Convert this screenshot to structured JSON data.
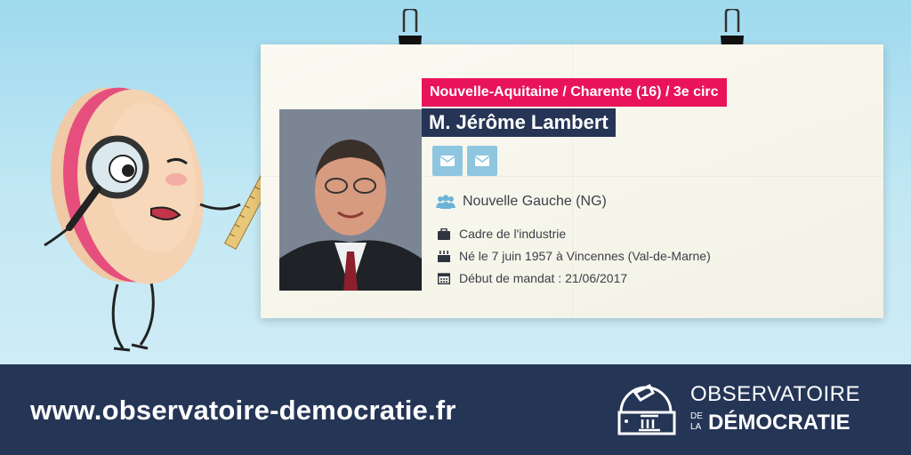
{
  "card": {
    "region": "Nouvelle-Aquitaine / Charente (16) / 3e circ",
    "name": "M. Jérôme Lambert",
    "party": "Nouvelle Gauche (NG)",
    "profession": "Cadre de l'industrie",
    "birth": "Né le 7 juin 1957 à Vincennes (Val-de-Marne)",
    "mandate_start": "Début de mandat : 21/06/2017",
    "icons": {
      "mail": "mail-icon",
      "party": "group-icon",
      "profession": "briefcase-icon",
      "birth": "birthday-cake-icon",
      "mandate": "calendar-icon"
    }
  },
  "footer": {
    "url": "www.observatoire-democratie.fr",
    "logo_top": "OBSERVATOIRE",
    "logo_de": "DE",
    "logo_la": "LA",
    "logo_bottom": "DÉMOCRATIE"
  },
  "colors": {
    "region_bg": "#e8135a",
    "name_bg": "#263555",
    "mail_bg": "#8ec6e0",
    "footer_bg": "#253556",
    "icon": "#6cb3d8"
  }
}
